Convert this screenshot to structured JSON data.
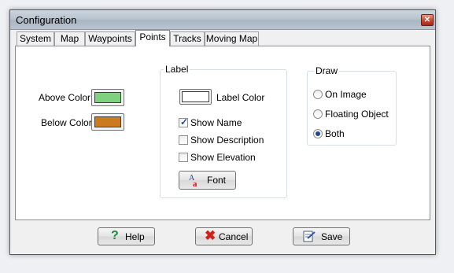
{
  "window": {
    "title": "Configuration",
    "close_glyph": "✕"
  },
  "tabs": [
    {
      "label": "System"
    },
    {
      "label": "Map"
    },
    {
      "label": "Waypoints"
    },
    {
      "label": "Points",
      "active": true
    },
    {
      "label": "Tracks"
    },
    {
      "label": "Moving Map"
    }
  ],
  "colors_section": {
    "above_label": "Above Color",
    "above_color": "#7fd17f",
    "below_label": "Below Color",
    "below_color": "#cc7a1f"
  },
  "label_group": {
    "legend": "Label",
    "label_color_text": "Label Color",
    "label_color": "#ffffff",
    "show_name": {
      "label": "Show Name",
      "checked": true
    },
    "show_description": {
      "label": "Show Description",
      "checked": false
    },
    "show_elevation": {
      "label": "Show Elevation",
      "checked": false
    },
    "font_button": {
      "label": "Font",
      "icon": "font-icon"
    }
  },
  "draw_group": {
    "legend": "Draw",
    "options": [
      {
        "label": "On Image",
        "selected": false
      },
      {
        "label": "Floating Object",
        "selected": false
      },
      {
        "label": "Both",
        "selected": true
      }
    ]
  },
  "footer": {
    "help": {
      "label": "Help",
      "icon": "help-icon"
    },
    "cancel": {
      "label": "Cancel",
      "icon": "cancel-icon"
    },
    "save": {
      "label": "Save",
      "icon": "save-icon"
    }
  }
}
